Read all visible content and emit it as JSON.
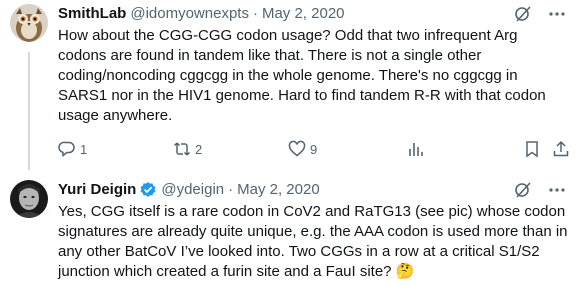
{
  "tweets": [
    {
      "name": "SmithLab",
      "handle": "@idomyownexpts",
      "separator": "·",
      "date": "May 2, 2020",
      "text": "How about the CGG-CGG codon usage? Odd that two infrequent Arg codons are found in tandem like that. There is not a single other coding/noncoding cggcgg in the whole genome. There's no cggcgg in SARS1 nor in the HIV1 genome. Hard to find tandem R-R with that codon usage anywhere.",
      "actions": {
        "replies": "1",
        "retweets": "2",
        "likes": "9"
      }
    },
    {
      "name": "Yuri Deigin",
      "handle": "@ydeigin",
      "separator": "·",
      "date": "May 2, 2020",
      "text": "Yes, CGG itself is a rare codon in CoV2 and RaTG13 (see pic) whose codon signatures are already quite unique, e.g. the AAA codon is used more than in any other BatCoV I’ve looked into. Two CGGs in a row at a critical S1/S2 junction which created a furin site and a FauI site? 🤔"
    }
  ],
  "colors": {
    "text": "#0f1419",
    "muted": "#536471",
    "verified": "#1d9bf0",
    "thread_line": "#cfd9de"
  },
  "icons": [
    "grok-icon",
    "more-icon",
    "reply-icon",
    "retweet-icon",
    "like-icon",
    "views-icon",
    "bookmark-icon",
    "share-icon",
    "verified-badge-icon"
  ]
}
